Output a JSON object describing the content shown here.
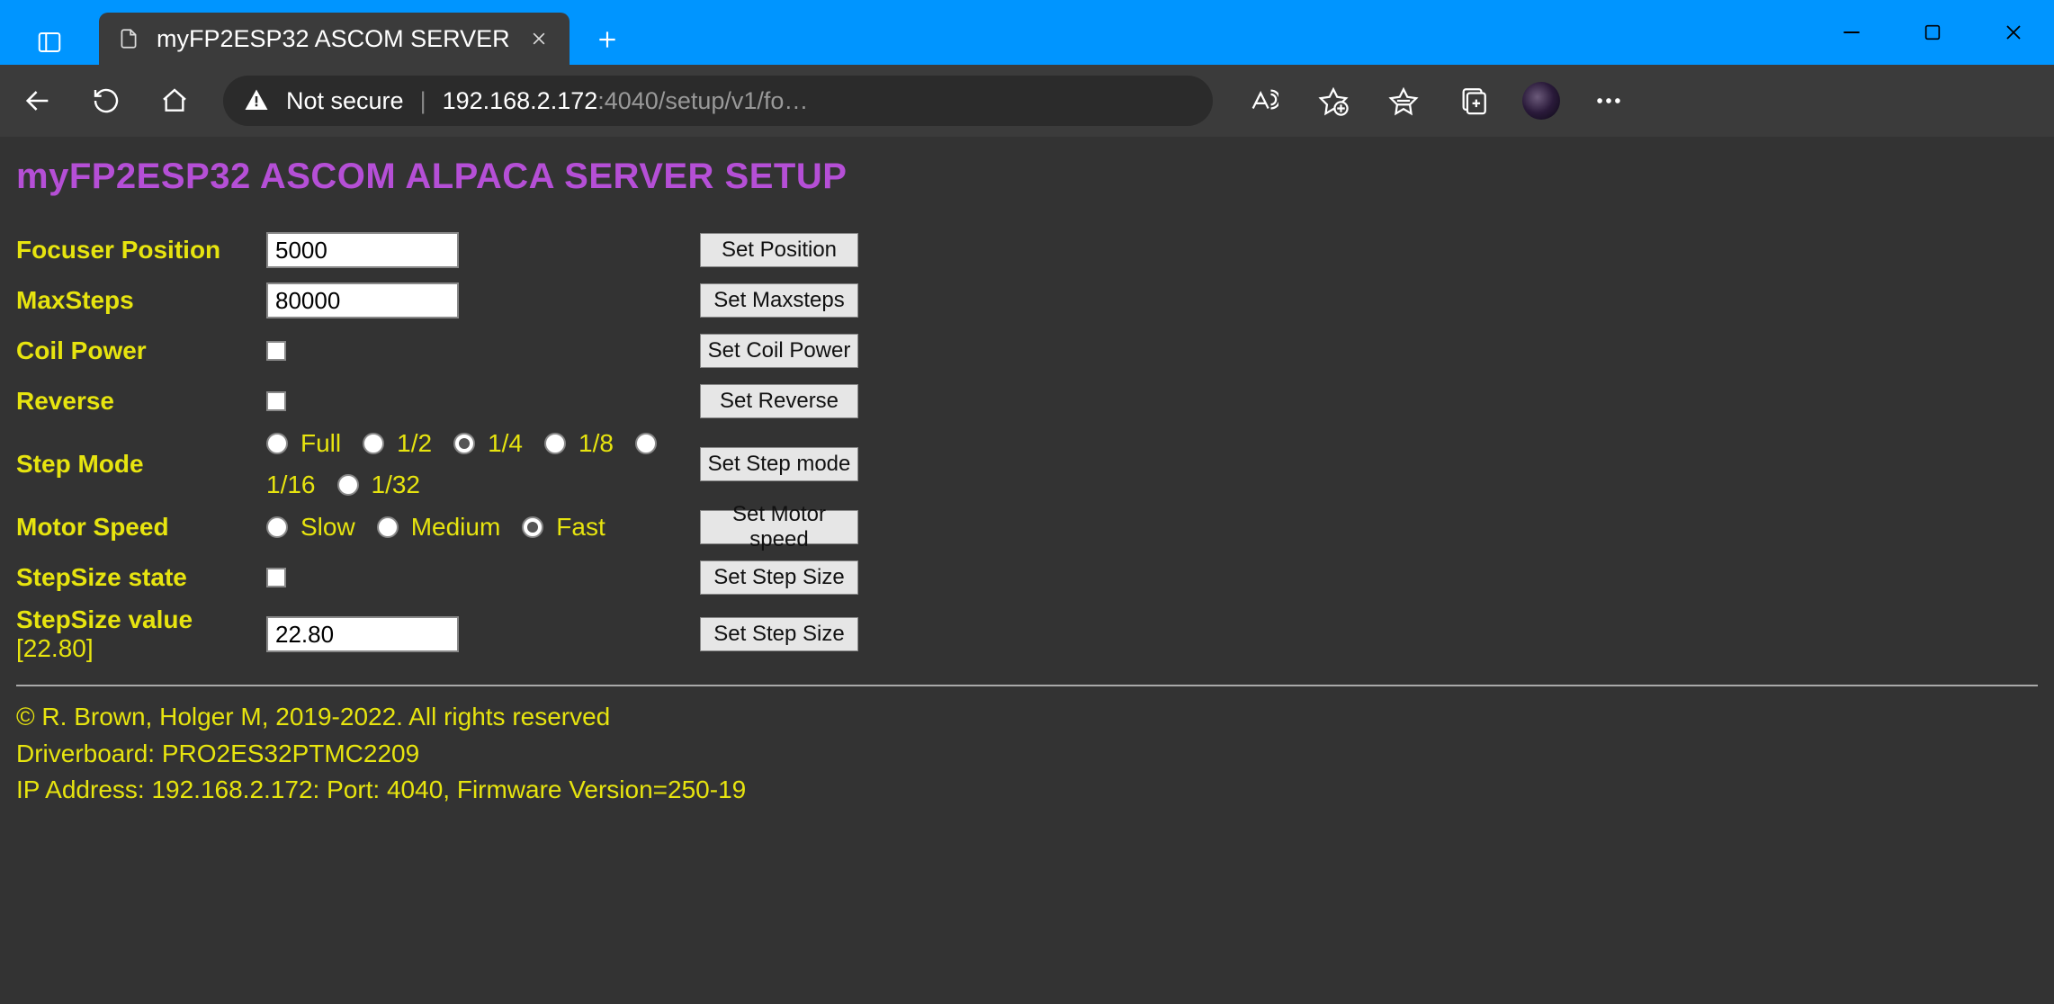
{
  "browser": {
    "tab_title": "myFP2ESP32 ASCOM SERVER",
    "not_secure_label": "Not secure",
    "url_host": "192.168.2.172",
    "url_rest": ":4040/setup/v1/fo…"
  },
  "page": {
    "title": "myFP2ESP32 ASCOM ALPACA SERVER SETUP"
  },
  "form": {
    "focuser_position": {
      "label": "Focuser Position",
      "value": "5000",
      "button": "Set Position"
    },
    "max_steps": {
      "label": "MaxSteps",
      "value": "80000",
      "button": "Set Maxsteps"
    },
    "coil_power": {
      "label": "Coil Power",
      "button": "Set Coil Power"
    },
    "reverse": {
      "label": "Reverse",
      "button": "Set Reverse"
    },
    "step_mode": {
      "label": "Step Mode",
      "options": [
        "Full",
        "1/2",
        "1/4",
        "1/8",
        "1/16",
        "1/32"
      ],
      "selected": "1/4",
      "button": "Set Step mode"
    },
    "motor_speed": {
      "label": "Motor Speed",
      "options": [
        "Slow",
        "Medium",
        "Fast"
      ],
      "selected": "Fast",
      "button": "Set Motor speed"
    },
    "stepsize_state": {
      "label": "StepSize state",
      "button": "Set Step Size"
    },
    "stepsize_value": {
      "label": "StepSize value",
      "sub": "[22.80]",
      "value": "22.80",
      "button": "Set Step Size"
    }
  },
  "footer": {
    "copyright": "© R. Brown, Holger M, 2019-2022. All rights reserved",
    "driverboard": "Driverboard: PRO2ES32PTMC2209",
    "ipinfo": "IP Address: 192.168.2.172: Port: 4040, Firmware Version=250-19"
  }
}
